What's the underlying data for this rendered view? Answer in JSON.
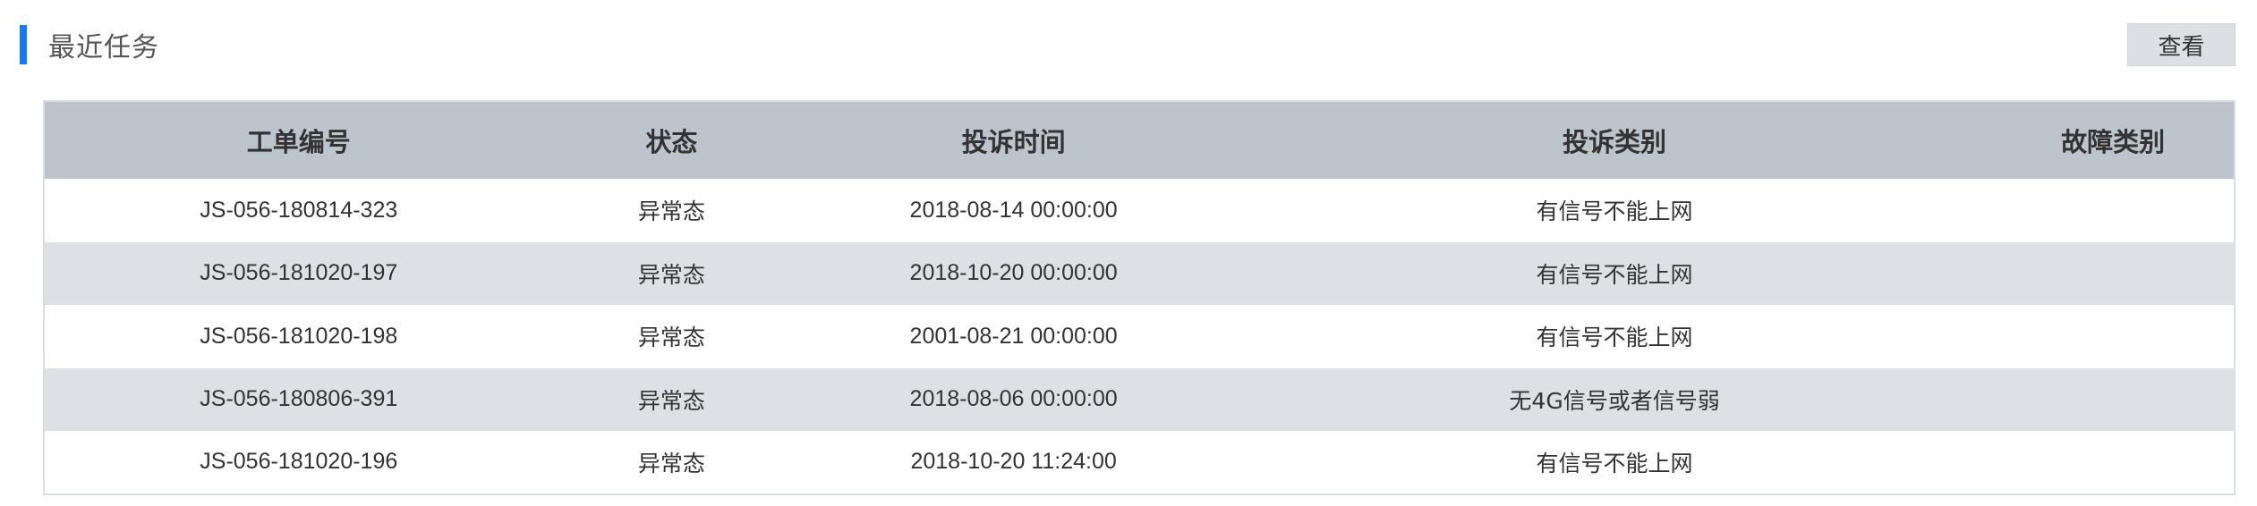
{
  "panel": {
    "title": "最近任务",
    "view_button_label": "查看"
  },
  "colors": {
    "accent": "#1677ff",
    "header_bg": "#bcc4cc",
    "stripe_bg": "#dde1e5",
    "button_bg": "#dcdfe3"
  },
  "table": {
    "headers": [
      "工单编号",
      "状态",
      "投诉时间",
      "投诉类别",
      "故障类别"
    ],
    "rows": [
      {
        "ticket_no": "JS-056-180814-323",
        "status": "异常态",
        "complaint_time": "2018-08-14 00:00:00",
        "complaint_type": "有信号不能上网",
        "fault_type": ""
      },
      {
        "ticket_no": "JS-056-181020-197",
        "status": "异常态",
        "complaint_time": "2018-10-20 00:00:00",
        "complaint_type": "有信号不能上网",
        "fault_type": ""
      },
      {
        "ticket_no": "JS-056-181020-198",
        "status": "异常态",
        "complaint_time": "2001-08-21 00:00:00",
        "complaint_type": "有信号不能上网",
        "fault_type": ""
      },
      {
        "ticket_no": "JS-056-180806-391",
        "status": "异常态",
        "complaint_time": "2018-08-06 00:00:00",
        "complaint_type": "无4G信号或者信号弱",
        "fault_type": ""
      },
      {
        "ticket_no": "JS-056-181020-196",
        "status": "异常态",
        "complaint_time": "2018-10-20 11:24:00",
        "complaint_type": "有信号不能上网",
        "fault_type": ""
      }
    ]
  }
}
